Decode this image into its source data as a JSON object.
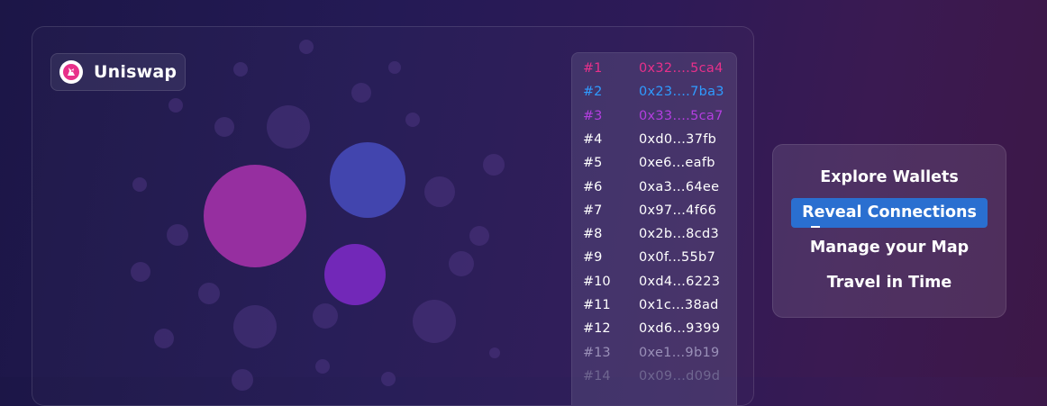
{
  "badge": {
    "label": "Uniswap",
    "icon": "unicorn-icon",
    "icon_color": "#e8308a"
  },
  "wallets": [
    {
      "rank": "#1",
      "address": "0x32....5ca4",
      "color": "#e8308a"
    },
    {
      "rank": "#2",
      "address": "0x23....7ba3",
      "color": "#2f9bff"
    },
    {
      "rank": "#3",
      "address": "0x33....5ca7",
      "color": "#b43ee0"
    },
    {
      "rank": "#4",
      "address": "0xd0...37fb",
      "color": "#ffffff"
    },
    {
      "rank": "#5",
      "address": "0xe6...eafb",
      "color": "#ffffff"
    },
    {
      "rank": "#6",
      "address": "0xa3...64ee",
      "color": "#ffffff"
    },
    {
      "rank": "#7",
      "address": "0x97...4f66",
      "color": "#ffffff"
    },
    {
      "rank": "#8",
      "address": "0x2b...8cd3",
      "color": "#ffffff"
    },
    {
      "rank": "#9",
      "address": "0x0f...55b7",
      "color": "#ffffff"
    },
    {
      "rank": "#10",
      "address": "0xd4...6223",
      "color": "#ffffff"
    },
    {
      "rank": "#11",
      "address": "0x1c...38ad",
      "color": "#ffffff"
    },
    {
      "rank": "#12",
      "address": "0xd6...9399",
      "color": "#ffffff"
    },
    {
      "rank": "#13",
      "address": "0xe1...9b19",
      "color": "#9a90b8"
    },
    {
      "rank": "#14",
      "address": "0x09...d09d",
      "color": "#6f6690"
    }
  ],
  "menu": {
    "items": [
      {
        "label": "Explore Wallets"
      },
      {
        "label": "Reveal Connections",
        "active": true
      },
      {
        "label": "Manage your Map"
      },
      {
        "label": "Travel in Time"
      }
    ]
  },
  "colors": {
    "accent": "#2a6fd0",
    "bubble_large": "#9b2fa5",
    "bubble_blue": "#4447b0",
    "bubble_violet": "#7a2fc0"
  }
}
